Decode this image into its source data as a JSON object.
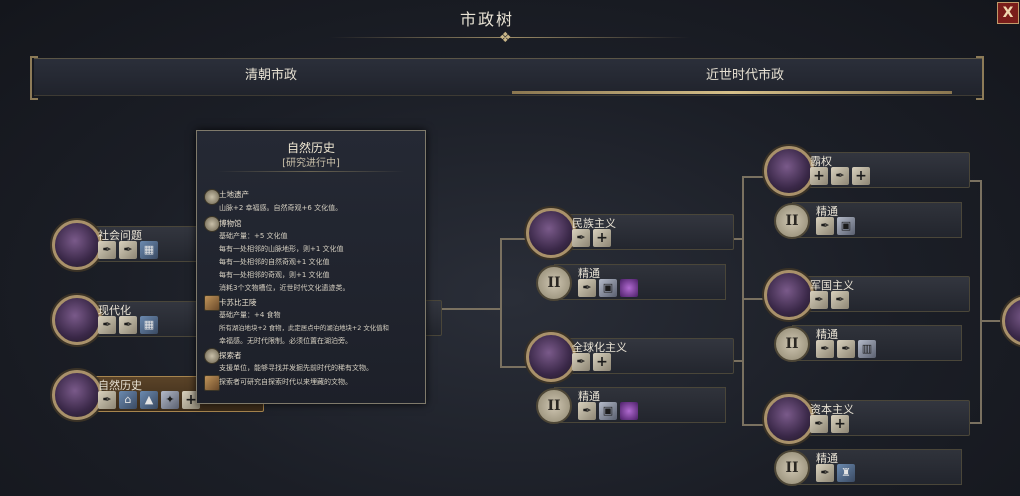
{
  "window": {
    "title": "市政树",
    "close_label": "X"
  },
  "tabs": [
    {
      "label": "清朝市政",
      "selected": false
    },
    {
      "label": "近世时代市政",
      "selected": true
    }
  ],
  "left_nodes": [
    {
      "label": "社会问题",
      "icons": [
        "quill-icon",
        "quill-icon",
        "building-icon"
      ]
    },
    {
      "label": "现代化",
      "icons": [
        "quill-icon",
        "quill-icon",
        "building-icon"
      ]
    },
    {
      "label": "自然历史",
      "icons": [
        "quill-icon",
        "building-icon",
        "building-icon",
        "bird-icon",
        "plus-icon"
      ]
    }
  ],
  "middle_nodes": [
    {
      "label": "民族主义",
      "icons": [
        "quill-icon",
        "plus-icon"
      ]
    },
    {
      "label": "精通",
      "roman": "II",
      "icons": [
        "quill-icon",
        "building-icon",
        "orb-icon"
      ]
    },
    {
      "label": "全球化主义",
      "icons": [
        "quill-icon",
        "plus-icon"
      ]
    },
    {
      "label": "精通",
      "roman": "II",
      "icons": [
        "quill-icon",
        "building-icon",
        "orb-icon"
      ]
    }
  ],
  "right_nodes": [
    {
      "label": "霸权",
      "icons": [
        "plus-icon",
        "quill-icon",
        "plus-icon"
      ]
    },
    {
      "label": "精通",
      "roman": "II",
      "icons": [
        "quill-icon",
        "building-icon"
      ]
    },
    {
      "label": "军国主义",
      "icons": [
        "quill-icon",
        "quill-icon"
      ]
    },
    {
      "label": "精通",
      "roman": "II",
      "icons": [
        "quill-icon",
        "quill-icon",
        "building-icon"
      ]
    },
    {
      "label": "资本主义",
      "icons": [
        "quill-icon",
        "plus-icon"
      ]
    },
    {
      "label": "精通",
      "roman": "II",
      "icons": [
        "quill-icon",
        "building-icon"
      ]
    }
  ],
  "tooltip": {
    "title": "自然历史",
    "subtitle": "[研究进行中]",
    "sections": [
      {
        "head": "土地遗产",
        "lines": [
          "山脉+2 幸福感。自然奇观+6 文化值。"
        ]
      },
      {
        "head": "博物馆",
        "lines": [
          "基础产量：+5 文化值",
          "每有一处相邻的山脉地形，则+1 文化值",
          "每有一处相邻的自然奇观+1 文化值",
          "每有一处相邻的奇观，则+1 文化值",
          "消耗3个文物槽位，近世时代文化遗迹类。"
        ]
      },
      {
        "head": "卡苏比王陵",
        "lines": [
          "基础产量：+4 食物",
          "所有湖泊地块+2 食物，此定居点中的湖泊地块+2 文化值和",
          "幸福感。无时代限制。必须位置在湖泊旁。"
        ]
      },
      {
        "head": "探索者",
        "lines": [
          "支援单位，能够寻找并发掘先前时代的稀有文物。"
        ]
      },
      {
        "head": "",
        "lines": [
          "探索者可研究自探索时代以来埋藏的文物。"
        ]
      }
    ]
  },
  "colors": {
    "accent": "#d6c08a",
    "close_bg": "#7a1d1a",
    "bg": "#1a1d25"
  }
}
